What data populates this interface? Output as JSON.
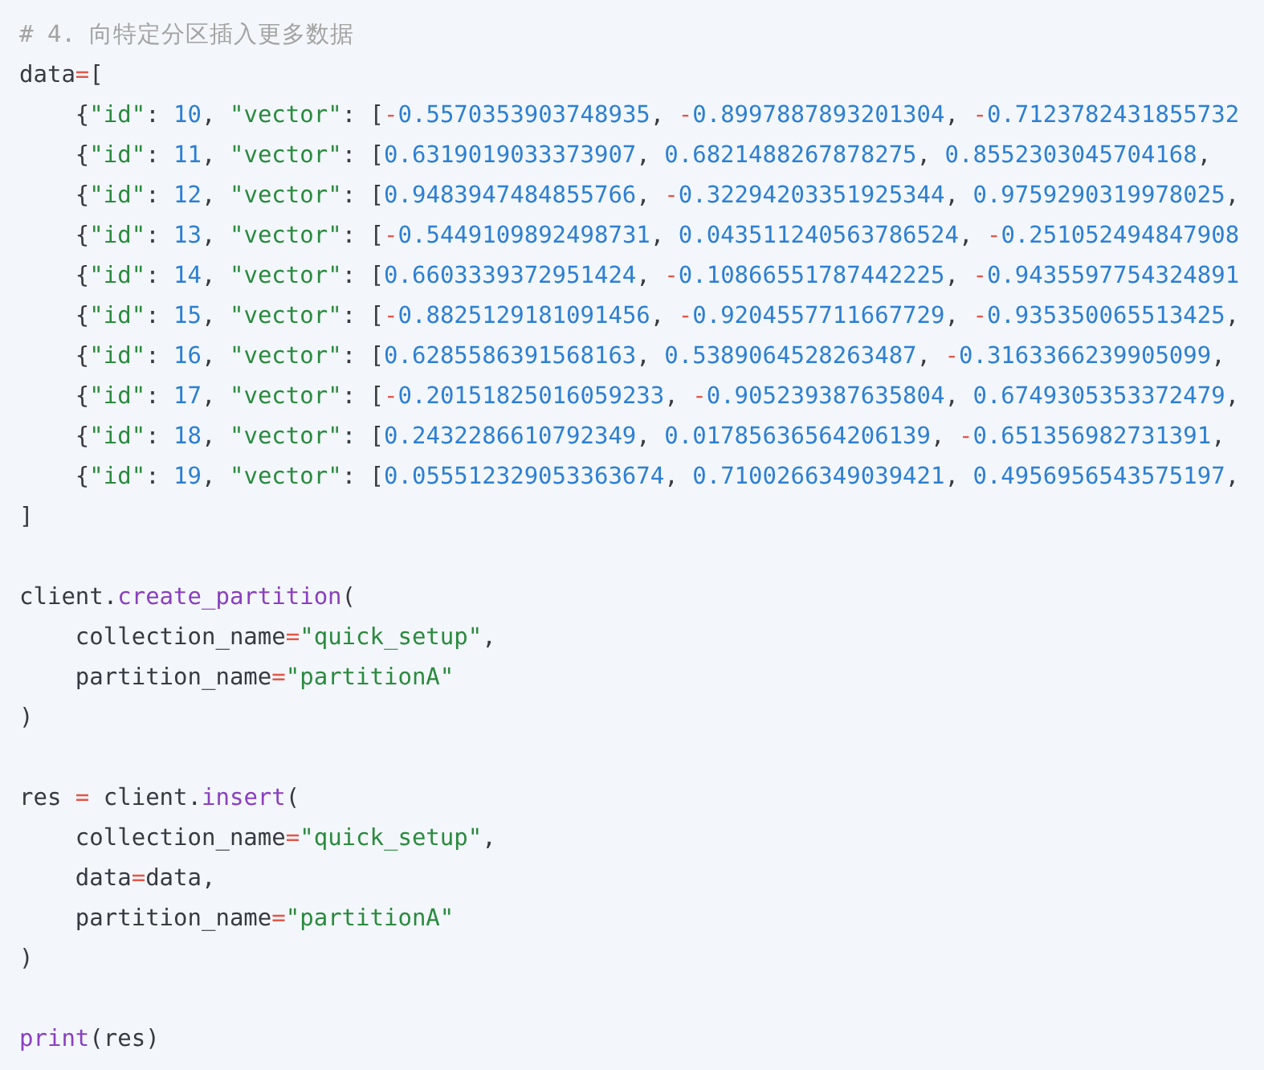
{
  "code_lines": [
    {
      "kind": "code",
      "tokens": [
        {
          "kind": "comment",
          "text": "# 4. 向特定分区插入更多数据"
        }
      ]
    },
    {
      "kind": "code",
      "tokens": [
        {
          "kind": "plain",
          "text": "data"
        },
        {
          "kind": "op",
          "text": "="
        },
        {
          "kind": "plain",
          "text": "["
        }
      ]
    },
    {
      "kind": "code",
      "tokens": [
        {
          "kind": "plain",
          "text": "    {"
        },
        {
          "kind": "str",
          "text": "\"id\""
        },
        {
          "kind": "plain",
          "text": ": "
        },
        {
          "kind": "num",
          "text": "10"
        },
        {
          "kind": "plain",
          "text": ", "
        },
        {
          "kind": "str",
          "text": "\"vector\""
        },
        {
          "kind": "plain",
          "text": ": ["
        },
        {
          "kind": "op",
          "text": "-"
        },
        {
          "kind": "num",
          "text": "0.5570353903748935"
        },
        {
          "kind": "plain",
          "text": ", "
        },
        {
          "kind": "op",
          "text": "-"
        },
        {
          "kind": "num",
          "text": "0.8997887893201304"
        },
        {
          "kind": "plain",
          "text": ", "
        },
        {
          "kind": "op",
          "text": "-"
        },
        {
          "kind": "num",
          "text": "0.7123782431855732"
        }
      ]
    },
    {
      "kind": "code",
      "tokens": [
        {
          "kind": "plain",
          "text": "    {"
        },
        {
          "kind": "str",
          "text": "\"id\""
        },
        {
          "kind": "plain",
          "text": ": "
        },
        {
          "kind": "num",
          "text": "11"
        },
        {
          "kind": "plain",
          "text": ", "
        },
        {
          "kind": "str",
          "text": "\"vector\""
        },
        {
          "kind": "plain",
          "text": ": ["
        },
        {
          "kind": "num",
          "text": "0.6319019033373907"
        },
        {
          "kind": "plain",
          "text": ", "
        },
        {
          "kind": "num",
          "text": "0.6821488267878275"
        },
        {
          "kind": "plain",
          "text": ", "
        },
        {
          "kind": "num",
          "text": "0.8552303045704168"
        },
        {
          "kind": "plain",
          "text": ","
        }
      ]
    },
    {
      "kind": "code",
      "tokens": [
        {
          "kind": "plain",
          "text": "    {"
        },
        {
          "kind": "str",
          "text": "\"id\""
        },
        {
          "kind": "plain",
          "text": ": "
        },
        {
          "kind": "num",
          "text": "12"
        },
        {
          "kind": "plain",
          "text": ", "
        },
        {
          "kind": "str",
          "text": "\"vector\""
        },
        {
          "kind": "plain",
          "text": ": ["
        },
        {
          "kind": "num",
          "text": "0.9483947484855766"
        },
        {
          "kind": "plain",
          "text": ", "
        },
        {
          "kind": "op",
          "text": "-"
        },
        {
          "kind": "num",
          "text": "0.32294203351925344"
        },
        {
          "kind": "plain",
          "text": ", "
        },
        {
          "kind": "num",
          "text": "0.9759290319978025"
        },
        {
          "kind": "plain",
          "text": ","
        }
      ]
    },
    {
      "kind": "code",
      "tokens": [
        {
          "kind": "plain",
          "text": "    {"
        },
        {
          "kind": "str",
          "text": "\"id\""
        },
        {
          "kind": "plain",
          "text": ": "
        },
        {
          "kind": "num",
          "text": "13"
        },
        {
          "kind": "plain",
          "text": ", "
        },
        {
          "kind": "str",
          "text": "\"vector\""
        },
        {
          "kind": "plain",
          "text": ": ["
        },
        {
          "kind": "op",
          "text": "-"
        },
        {
          "kind": "num",
          "text": "0.5449109892498731"
        },
        {
          "kind": "plain",
          "text": ", "
        },
        {
          "kind": "num",
          "text": "0.043511240563786524"
        },
        {
          "kind": "plain",
          "text": ", "
        },
        {
          "kind": "op",
          "text": "-"
        },
        {
          "kind": "num",
          "text": "0.251052494847908"
        }
      ]
    },
    {
      "kind": "code",
      "tokens": [
        {
          "kind": "plain",
          "text": "    {"
        },
        {
          "kind": "str",
          "text": "\"id\""
        },
        {
          "kind": "plain",
          "text": ": "
        },
        {
          "kind": "num",
          "text": "14"
        },
        {
          "kind": "plain",
          "text": ", "
        },
        {
          "kind": "str",
          "text": "\"vector\""
        },
        {
          "kind": "plain",
          "text": ": ["
        },
        {
          "kind": "num",
          "text": "0.6603339372951424"
        },
        {
          "kind": "plain",
          "text": ", "
        },
        {
          "kind": "op",
          "text": "-"
        },
        {
          "kind": "num",
          "text": "0.10866551787442225"
        },
        {
          "kind": "plain",
          "text": ", "
        },
        {
          "kind": "op",
          "text": "-"
        },
        {
          "kind": "num",
          "text": "0.9435597754324891"
        }
      ]
    },
    {
      "kind": "code",
      "tokens": [
        {
          "kind": "plain",
          "text": "    {"
        },
        {
          "kind": "str",
          "text": "\"id\""
        },
        {
          "kind": "plain",
          "text": ": "
        },
        {
          "kind": "num",
          "text": "15"
        },
        {
          "kind": "plain",
          "text": ", "
        },
        {
          "kind": "str",
          "text": "\"vector\""
        },
        {
          "kind": "plain",
          "text": ": ["
        },
        {
          "kind": "op",
          "text": "-"
        },
        {
          "kind": "num",
          "text": "0.8825129181091456"
        },
        {
          "kind": "plain",
          "text": ", "
        },
        {
          "kind": "op",
          "text": "-"
        },
        {
          "kind": "num",
          "text": "0.9204557711667729"
        },
        {
          "kind": "plain",
          "text": ", "
        },
        {
          "kind": "op",
          "text": "-"
        },
        {
          "kind": "num",
          "text": "0.935350065513425"
        },
        {
          "kind": "plain",
          "text": ","
        }
      ]
    },
    {
      "kind": "code",
      "tokens": [
        {
          "kind": "plain",
          "text": "    {"
        },
        {
          "kind": "str",
          "text": "\"id\""
        },
        {
          "kind": "plain",
          "text": ": "
        },
        {
          "kind": "num",
          "text": "16"
        },
        {
          "kind": "plain",
          "text": ", "
        },
        {
          "kind": "str",
          "text": "\"vector\""
        },
        {
          "kind": "plain",
          "text": ": ["
        },
        {
          "kind": "num",
          "text": "0.6285586391568163"
        },
        {
          "kind": "plain",
          "text": ", "
        },
        {
          "kind": "num",
          "text": "0.5389064528263487"
        },
        {
          "kind": "plain",
          "text": ", "
        },
        {
          "kind": "op",
          "text": "-"
        },
        {
          "kind": "num",
          "text": "0.3163366239905099"
        },
        {
          "kind": "plain",
          "text": ","
        }
      ]
    },
    {
      "kind": "code",
      "tokens": [
        {
          "kind": "plain",
          "text": "    {"
        },
        {
          "kind": "str",
          "text": "\"id\""
        },
        {
          "kind": "plain",
          "text": ": "
        },
        {
          "kind": "num",
          "text": "17"
        },
        {
          "kind": "plain",
          "text": ", "
        },
        {
          "kind": "str",
          "text": "\"vector\""
        },
        {
          "kind": "plain",
          "text": ": ["
        },
        {
          "kind": "op",
          "text": "-"
        },
        {
          "kind": "num",
          "text": "0.20151825016059233"
        },
        {
          "kind": "plain",
          "text": ", "
        },
        {
          "kind": "op",
          "text": "-"
        },
        {
          "kind": "num",
          "text": "0.905239387635804"
        },
        {
          "kind": "plain",
          "text": ", "
        },
        {
          "kind": "num",
          "text": "0.6749305353372479"
        },
        {
          "kind": "plain",
          "text": ","
        }
      ]
    },
    {
      "kind": "code",
      "tokens": [
        {
          "kind": "plain",
          "text": "    {"
        },
        {
          "kind": "str",
          "text": "\"id\""
        },
        {
          "kind": "plain",
          "text": ": "
        },
        {
          "kind": "num",
          "text": "18"
        },
        {
          "kind": "plain",
          "text": ", "
        },
        {
          "kind": "str",
          "text": "\"vector\""
        },
        {
          "kind": "plain",
          "text": ": ["
        },
        {
          "kind": "num",
          "text": "0.2432286610792349"
        },
        {
          "kind": "plain",
          "text": ", "
        },
        {
          "kind": "num",
          "text": "0.01785636564206139"
        },
        {
          "kind": "plain",
          "text": ", "
        },
        {
          "kind": "op",
          "text": "-"
        },
        {
          "kind": "num",
          "text": "0.651356982731391"
        },
        {
          "kind": "plain",
          "text": ","
        }
      ]
    },
    {
      "kind": "code",
      "tokens": [
        {
          "kind": "plain",
          "text": "    {"
        },
        {
          "kind": "str",
          "text": "\"id\""
        },
        {
          "kind": "plain",
          "text": ": "
        },
        {
          "kind": "num",
          "text": "19"
        },
        {
          "kind": "plain",
          "text": ", "
        },
        {
          "kind": "str",
          "text": "\"vector\""
        },
        {
          "kind": "plain",
          "text": ": ["
        },
        {
          "kind": "num",
          "text": "0.055512329053363674"
        },
        {
          "kind": "plain",
          "text": ", "
        },
        {
          "kind": "num",
          "text": "0.7100266349039421"
        },
        {
          "kind": "plain",
          "text": ", "
        },
        {
          "kind": "num",
          "text": "0.4956956543575197"
        },
        {
          "kind": "plain",
          "text": ","
        }
      ]
    },
    {
      "kind": "code",
      "tokens": [
        {
          "kind": "plain",
          "text": "]"
        }
      ]
    },
    {
      "kind": "blank"
    },
    {
      "kind": "code",
      "tokens": [
        {
          "kind": "plain",
          "text": "client."
        },
        {
          "kind": "fn",
          "text": "create_partition"
        },
        {
          "kind": "plain",
          "text": "("
        }
      ]
    },
    {
      "kind": "code",
      "tokens": [
        {
          "kind": "plain",
          "text": "    collection_name"
        },
        {
          "kind": "op",
          "text": "="
        },
        {
          "kind": "str",
          "text": "\"quick_setup\""
        },
        {
          "kind": "plain",
          "text": ","
        }
      ]
    },
    {
      "kind": "code",
      "tokens": [
        {
          "kind": "plain",
          "text": "    partition_name"
        },
        {
          "kind": "op",
          "text": "="
        },
        {
          "kind": "str",
          "text": "\"partitionA\""
        }
      ]
    },
    {
      "kind": "code",
      "tokens": [
        {
          "kind": "plain",
          "text": ")"
        }
      ]
    },
    {
      "kind": "blank"
    },
    {
      "kind": "code",
      "tokens": [
        {
          "kind": "plain",
          "text": "res "
        },
        {
          "kind": "op",
          "text": "="
        },
        {
          "kind": "plain",
          "text": " client."
        },
        {
          "kind": "fn",
          "text": "insert"
        },
        {
          "kind": "plain",
          "text": "("
        }
      ]
    },
    {
      "kind": "code",
      "tokens": [
        {
          "kind": "plain",
          "text": "    collection_name"
        },
        {
          "kind": "op",
          "text": "="
        },
        {
          "kind": "str",
          "text": "\"quick_setup\""
        },
        {
          "kind": "plain",
          "text": ","
        }
      ]
    },
    {
      "kind": "code",
      "tokens": [
        {
          "kind": "plain",
          "text": "    data"
        },
        {
          "kind": "op",
          "text": "="
        },
        {
          "kind": "plain",
          "text": "data,"
        }
      ]
    },
    {
      "kind": "code",
      "tokens": [
        {
          "kind": "plain",
          "text": "    partition_name"
        },
        {
          "kind": "op",
          "text": "="
        },
        {
          "kind": "str",
          "text": "\"partitionA\""
        }
      ]
    },
    {
      "kind": "code",
      "tokens": [
        {
          "kind": "plain",
          "text": ")"
        }
      ]
    },
    {
      "kind": "blank"
    },
    {
      "kind": "code",
      "tokens": [
        {
          "kind": "fn",
          "text": "print"
        },
        {
          "kind": "plain",
          "text": "(res)"
        }
      ]
    }
  ]
}
